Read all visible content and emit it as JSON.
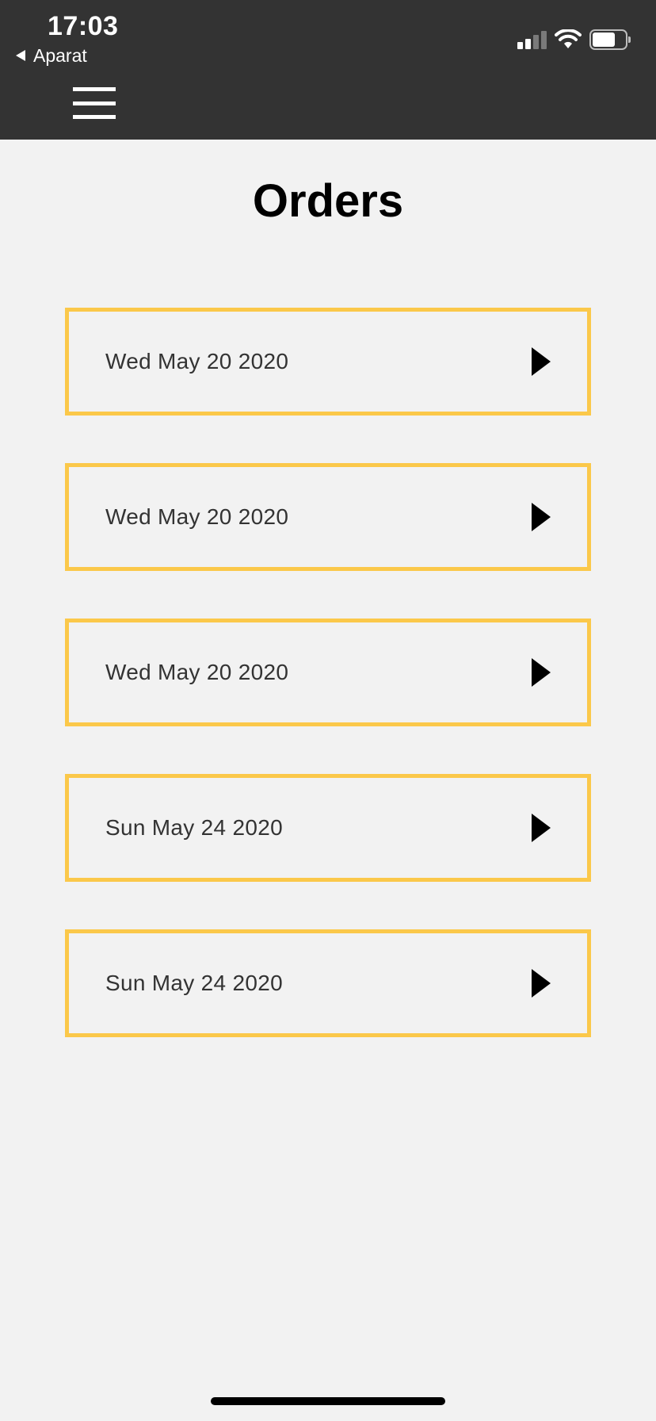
{
  "status_bar": {
    "time": "17:03",
    "back_app": "Aparat",
    "icons": [
      "cellular-signal-icon",
      "wifi-icon",
      "battery-icon"
    ]
  },
  "header": {
    "background": "#333333",
    "menu_icon": "hamburger-menu-icon"
  },
  "page": {
    "title": "Orders",
    "background": "#f2f2f2"
  },
  "orders": [
    {
      "date": "Wed May 20 2020"
    },
    {
      "date": "Wed May 20 2020"
    },
    {
      "date": "Wed May 20 2020"
    },
    {
      "date": "Sun May 24 2020"
    },
    {
      "date": "Sun May 24 2020"
    }
  ],
  "colors": {
    "accent_border": "#fbc84a",
    "text": "#333333",
    "arrow": "#000000"
  }
}
